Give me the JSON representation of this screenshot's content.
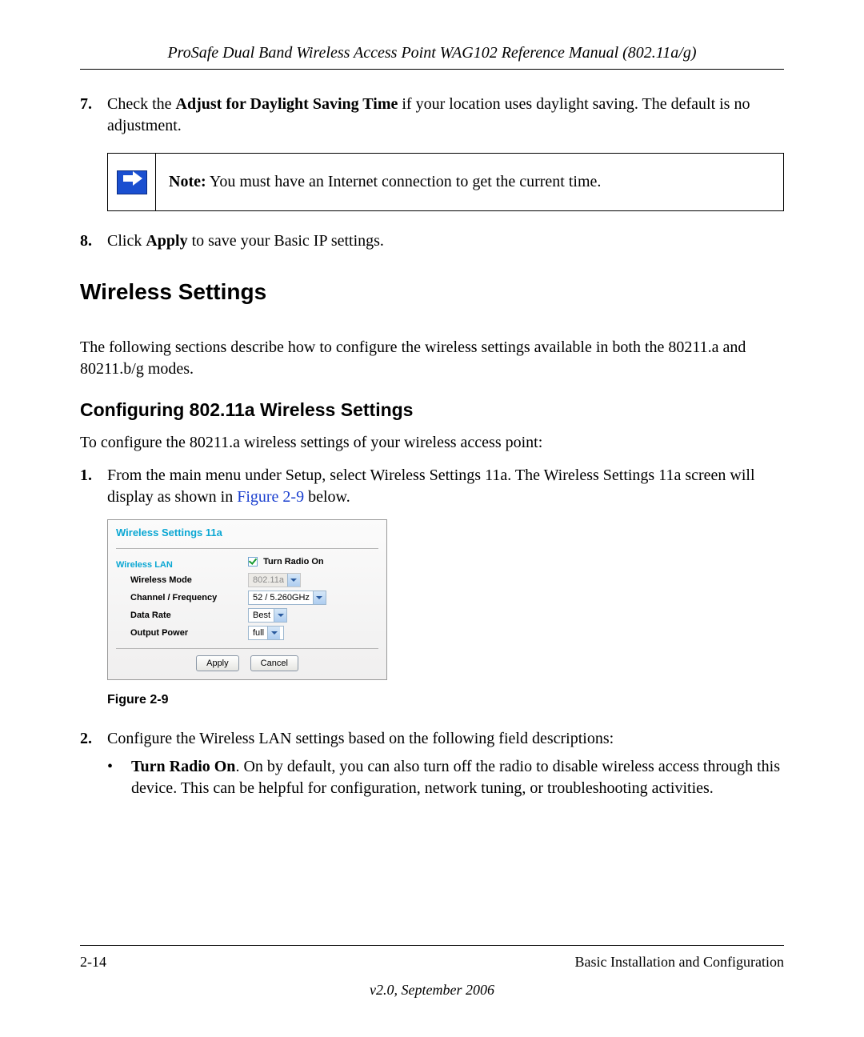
{
  "header": {
    "title": "ProSafe Dual Band Wireless Access Point WAG102 Reference Manual (802.11a/g)"
  },
  "step7": {
    "num": "7.",
    "pre": "Check the ",
    "bold": "Adjust for Daylight Saving Time",
    "post": " if your location uses daylight saving. The default is no adjustment."
  },
  "note": {
    "label": "Note:",
    "text": " You must have an Internet connection to get the current time."
  },
  "step8": {
    "num": "8.",
    "pre": "Click ",
    "bold": "Apply",
    "post": " to save your Basic IP settings."
  },
  "h1": "Wireless Settings",
  "intro": "The following sections describe how to configure the wireless settings available in both the 80211.a and 80211.b/g modes.",
  "h2": "Configuring 802.11a Wireless Settings",
  "p2": "To configure the 80211.a wireless settings of your wireless access point:",
  "step1": {
    "num": "1.",
    "pre": "From the main menu under Setup, select Wireless Settings 11a. The Wireless Settings 11a screen will display as shown in ",
    "link": "Figure 2-9",
    "post": " below."
  },
  "panel": {
    "title": "Wireless Settings 11a",
    "section": "Wireless LAN",
    "turn_radio": "Turn Radio On",
    "rows": {
      "mode_label": "Wireless Mode",
      "mode_value": "802.11a",
      "chan_label": "Channel / Frequency",
      "chan_value": "52 / 5.260GHz",
      "rate_label": "Data Rate",
      "rate_value": "Best",
      "power_label": "Output Power",
      "power_value": "full"
    },
    "apply": "Apply",
    "cancel": "Cancel"
  },
  "figure_caption": "Figure 2-9",
  "step2": {
    "num": "2.",
    "text": "Configure the Wireless LAN settings based on the following field descriptions:"
  },
  "bullet1": {
    "dot": "•",
    "bold": "Turn Radio On",
    "post": ". On by default, you can also turn off the radio to disable wireless access through this device. This can be helpful for configuration, network tuning, or troubleshooting activities."
  },
  "footer": {
    "page": "2-14",
    "section": "Basic Installation and Configuration",
    "version": "v2.0, September 2006"
  }
}
